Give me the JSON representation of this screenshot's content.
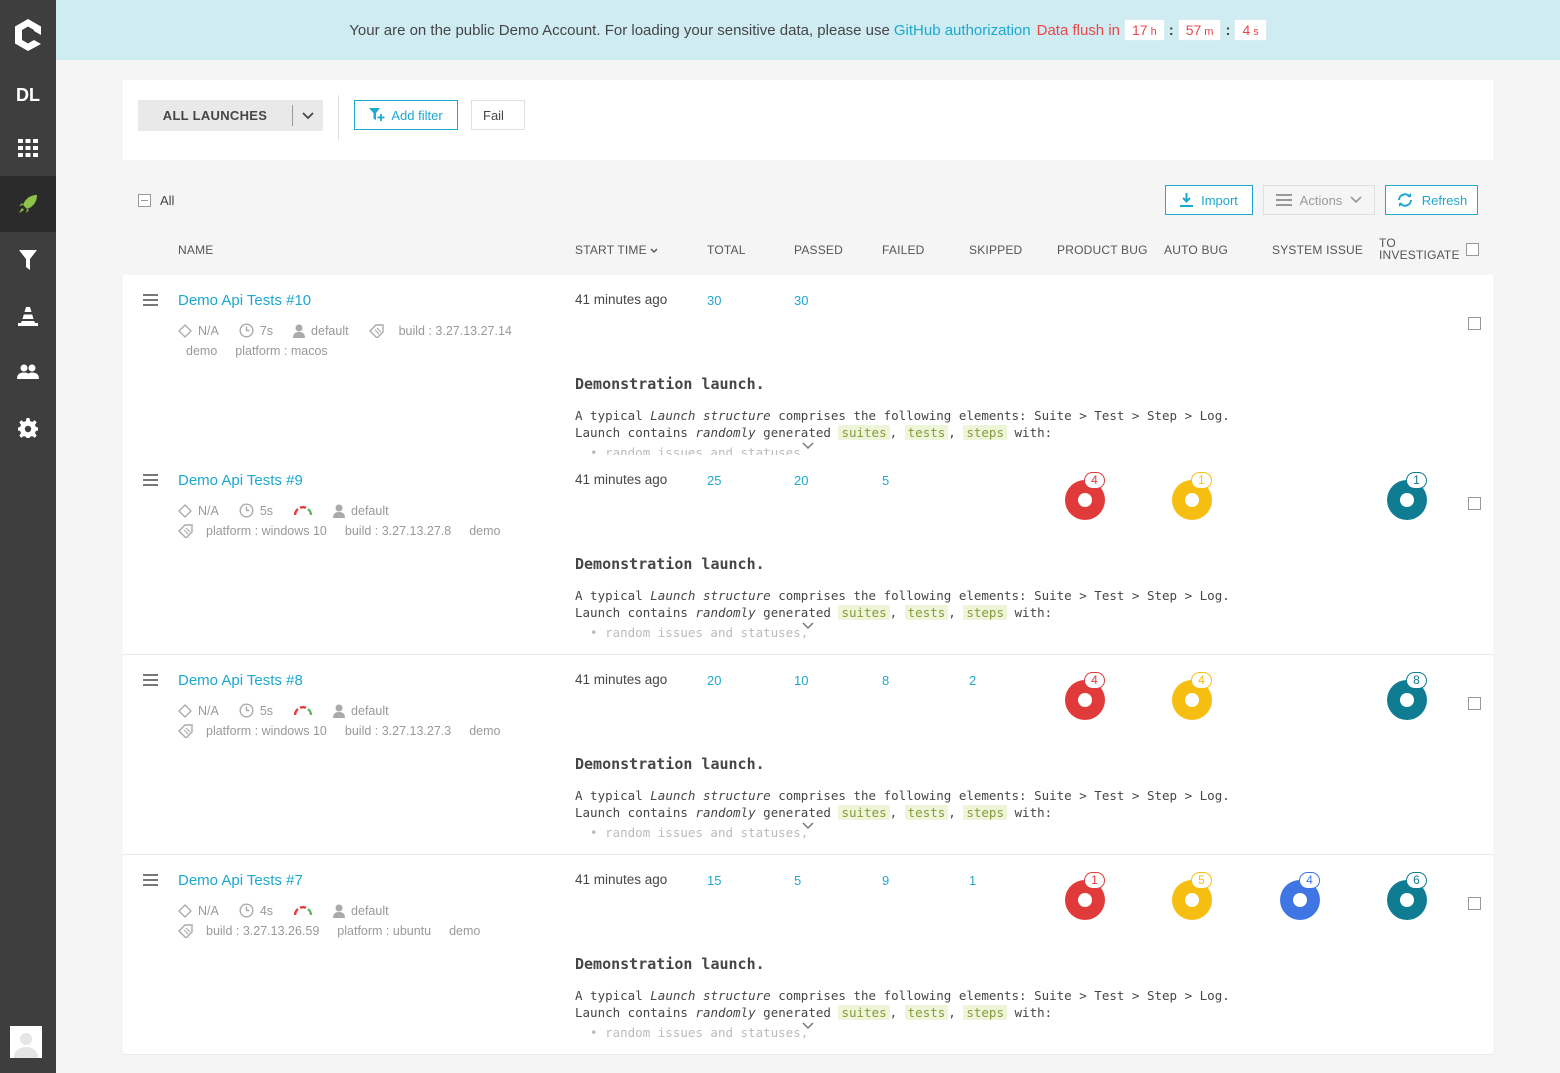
{
  "project_initials": "DL",
  "banner": {
    "text": "Your are on the public Demo Account. For loading your sensitive data, please use",
    "link": "GitHub authorization",
    "flush": "Data flush in",
    "hours": "17",
    "hours_unit": "h",
    "minutes": "57",
    "minutes_unit": "m",
    "seconds": "4",
    "seconds_unit": "s"
  },
  "filter": {
    "launches_label": "ALL LAUNCHES",
    "add_filter": "Add filter",
    "fail_chip": "Fail"
  },
  "toolbar": {
    "select_all": "All",
    "import": "Import",
    "actions": "Actions",
    "refresh": "Refresh"
  },
  "columns": {
    "name": "NAME",
    "start_time": "START TIME",
    "total": "TOTAL",
    "passed": "PASSED",
    "failed": "FAILED",
    "skipped": "SKIPPED",
    "product_bug": "PRODUCT BUG",
    "auto_bug": "AUTO BUG",
    "system_issue": "SYSTEM ISSUE",
    "to_investigate_1": "TO",
    "to_investigate_2": "INVESTIGATE"
  },
  "colors": {
    "accent": "#1da8cf",
    "product_bug": "#e03a3a",
    "auto_bug": "#f7be12",
    "system_issue": "#3f76e3",
    "to_investigate": "#0f7c91"
  },
  "description": {
    "title": "Demonstration launch.",
    "line1_a": "A typical ",
    "line1_em": "Launch structure",
    "line1_b": " comprises the following elements: Suite > Test > Step > Log.",
    "line2_a": "Launch contains ",
    "line2_em": "randomly",
    "line2_b": " generated ",
    "tag1": "suites",
    "tag2": "tests",
    "tag3": "steps",
    "line2_c": " with:",
    "bullet": "random issues and statuses,"
  },
  "launches": [
    {
      "name": "Demo Api Tests #10",
      "owner_na": "N/A",
      "duration": "7s",
      "user": "default",
      "attrs_inline": [
        "build : 3.27.13.27.14"
      ],
      "attrs": [
        "demo",
        "platform : macos"
      ],
      "start_time": "41 minutes ago",
      "total": "30",
      "passed": "30",
      "failed": "",
      "skipped": "",
      "product_bug": "",
      "auto_bug": "",
      "system_issue": "",
      "to_investigate": ""
    },
    {
      "name": "Demo Api Tests #9",
      "owner_na": "N/A",
      "duration": "5s",
      "user": "default",
      "attrs_inline": [],
      "attrs": [
        "platform : windows 10",
        "build : 3.27.13.27.8",
        "demo"
      ],
      "start_time": "41 minutes ago",
      "total": "25",
      "passed": "20",
      "failed": "5",
      "skipped": "",
      "product_bug": "4",
      "auto_bug": "1",
      "system_issue": "",
      "to_investigate": "1"
    },
    {
      "name": "Demo Api Tests #8",
      "owner_na": "N/A",
      "duration": "5s",
      "user": "default",
      "attrs_inline": [],
      "attrs": [
        "platform : windows 10",
        "build : 3.27.13.27.3",
        "demo"
      ],
      "start_time": "41 minutes ago",
      "total": "20",
      "passed": "10",
      "failed": "8",
      "skipped": "2",
      "product_bug": "4",
      "auto_bug": "4",
      "system_issue": "",
      "to_investigate": "8"
    },
    {
      "name": "Demo Api Tests #7",
      "owner_na": "N/A",
      "duration": "4s",
      "user": "default",
      "attrs_inline": [],
      "attrs": [
        "build : 3.27.13.26.59",
        "platform : ubuntu",
        "demo"
      ],
      "start_time": "41 minutes ago",
      "total": "15",
      "passed": "5",
      "failed": "9",
      "skipped": "1",
      "product_bug": "1",
      "auto_bug": "5",
      "system_issue": "4",
      "to_investigate": "6"
    }
  ]
}
